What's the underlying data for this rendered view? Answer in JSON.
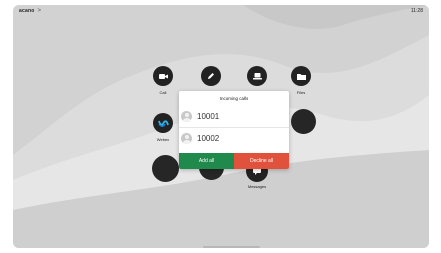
{
  "status_bar": {
    "brand": "acano",
    "chevron": ">",
    "time": "11:28"
  },
  "apps": [
    {
      "label": "Call",
      "icon": "camera-icon"
    },
    {
      "label": "",
      "icon": "pencil-icon"
    },
    {
      "label": "",
      "icon": "share-screen-icon"
    },
    {
      "label": "Files",
      "icon": "folder-icon"
    },
    {
      "label": "Webex",
      "icon": "webex-logo-icon"
    },
    {
      "label": "Messages",
      "icon": "message-icon"
    }
  ],
  "dialog": {
    "title": "Incoming calls",
    "calls": [
      {
        "number": "10001"
      },
      {
        "number": "10002"
      }
    ],
    "add_all_label": "Add all",
    "decline_all_label": "Decline all"
  },
  "colors": {
    "accept": "#1f8a4c",
    "decline": "#e1523d",
    "tile": "#222222"
  }
}
